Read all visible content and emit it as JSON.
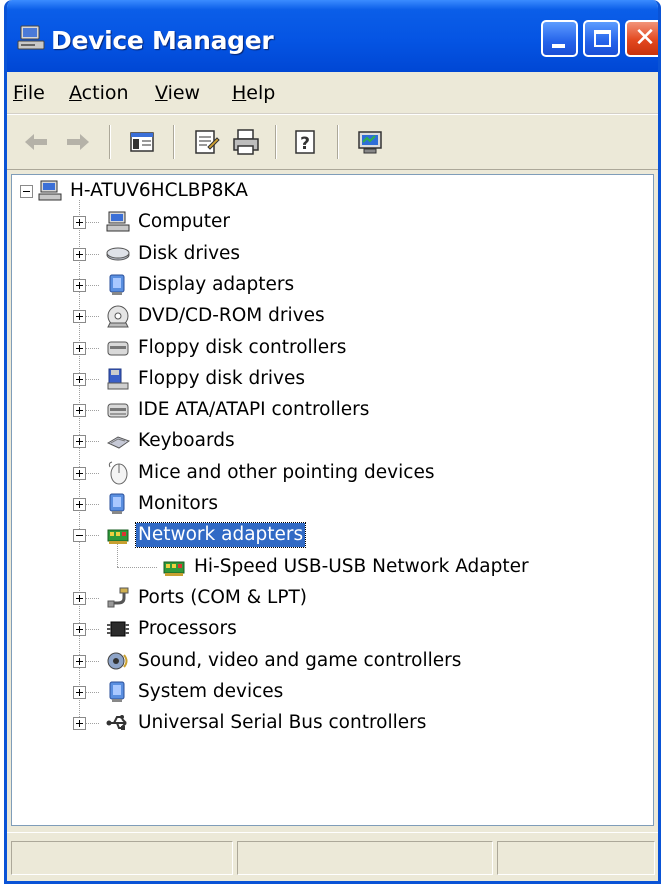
{
  "window": {
    "title": "Device Manager",
    "accent_color": "#0554e3",
    "close_color": "#e3481f",
    "close_glyph": "✕"
  },
  "menu": [
    {
      "prefix": "",
      "mnemonic": "F",
      "rest": "ile"
    },
    {
      "prefix": "",
      "mnemonic": "A",
      "rest": "ction"
    },
    {
      "prefix": "",
      "mnemonic": "V",
      "rest": "iew"
    },
    {
      "prefix": "",
      "mnemonic": "H",
      "rest": "elp"
    }
  ],
  "toolbar": {
    "buttons": [
      "back-arrow-icon",
      "forward-arrow-icon",
      "show-hide-console-tree-icon",
      "properties-icon",
      "print-icon",
      "help-icon",
      "scan-hardware-icon"
    ]
  },
  "tree": {
    "root": {
      "label": "H-ATUV6HCLBP8KA",
      "icon": "computer-icon",
      "expanded": true
    },
    "categories": [
      {
        "label": "Computer",
        "icon": "computer-icon",
        "expanded": false
      },
      {
        "label": "Disk drives",
        "icon": "disk-drive-icon",
        "expanded": false
      },
      {
        "label": "Display adapters",
        "icon": "display-adapter-icon",
        "expanded": false
      },
      {
        "label": "DVD/CD-ROM drives",
        "icon": "cdrom-icon",
        "expanded": false
      },
      {
        "label": "Floppy disk controllers",
        "icon": "floppy-controller-icon",
        "expanded": false
      },
      {
        "label": "Floppy disk drives",
        "icon": "floppy-drive-icon",
        "expanded": false
      },
      {
        "label": "IDE ATA/ATAPI controllers",
        "icon": "ide-controller-icon",
        "expanded": false
      },
      {
        "label": "Keyboards",
        "icon": "keyboard-icon",
        "expanded": false
      },
      {
        "label": "Mice and other pointing devices",
        "icon": "mouse-icon",
        "expanded": false
      },
      {
        "label": "Monitors",
        "icon": "monitor-icon",
        "expanded": false
      },
      {
        "label": "Network adapters",
        "icon": "network-adapter-icon",
        "expanded": true,
        "selected": true,
        "children": [
          {
            "label": "Hi-Speed USB-USB Network Adapter",
            "icon": "network-adapter-icon"
          }
        ]
      },
      {
        "label": "Ports (COM & LPT)",
        "icon": "port-icon",
        "expanded": false
      },
      {
        "label": "Processors",
        "icon": "processor-icon",
        "expanded": false
      },
      {
        "label": "Sound, video and game controllers",
        "icon": "sound-icon",
        "expanded": false
      },
      {
        "label": "System devices",
        "icon": "system-device-icon",
        "expanded": false
      },
      {
        "label": "Universal Serial Bus controllers",
        "icon": "usb-icon",
        "expanded": false
      }
    ],
    "selection_color": "#316ac5"
  }
}
